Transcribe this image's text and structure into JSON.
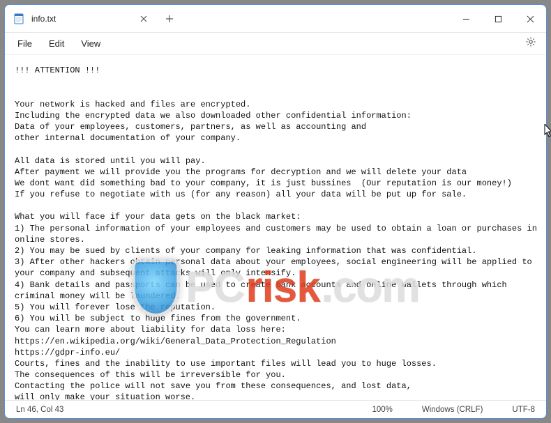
{
  "tab": {
    "title": "info.txt"
  },
  "menubar": {
    "items": [
      "File",
      "Edit",
      "View"
    ]
  },
  "editor": {
    "lines": [
      "!!! ATTENTION !!!",
      "",
      "",
      "Your network is hacked and files are encrypted.",
      "Including the encrypted data we also downloaded other confidential information:",
      "Data of your employees, customers, partners, as well as accounting and",
      "other internal documentation of your company.",
      "",
      "All data is stored until you will pay.",
      "After payment we will provide you the programs for decryption and we will delete your data",
      "We dont want did something bad to your company, it is just bussines  (Our reputation is our money!)",
      "If you refuse to negotiate with us (for any reason) all your data will be put up for sale.",
      "",
      "What you will face if your data gets on the black market:",
      "1) The personal information of your employees and customers may be used to obtain a loan or purchases in online stores.",
      "2) You may be sued by clients of your company for leaking information that was confidential.",
      "3) After other hackers obtain personal data about your employees, social engineering will be applied to your company and subsequent attacks will only intensify.",
      "4) Bank details and passports can be used to create bank accounts and online wallets through which criminal money will be laundered.",
      "5) You will forever lose the reputation.",
      "6) You will be subject to huge fines from the government.",
      "You can learn more about liability for data loss here:",
      "https://en.wikipedia.org/wiki/General_Data_Protection_Regulation",
      "https://gdpr-info.eu/",
      "Courts, fines and the inability to use important files will lead you to huge losses.",
      "The consequences of this will be irreversible for you.",
      "Contacting the police will not save you from these consequences, and lost data,",
      "will only make your situation worse."
    ]
  },
  "statusbar": {
    "cursor": "Ln 46, Col 43",
    "zoom": "100%",
    "eol": "Windows (CRLF)",
    "encoding": "UTF-8"
  },
  "watermark": {
    "pc": "PC",
    "risk": "risk",
    "com": ".com"
  }
}
